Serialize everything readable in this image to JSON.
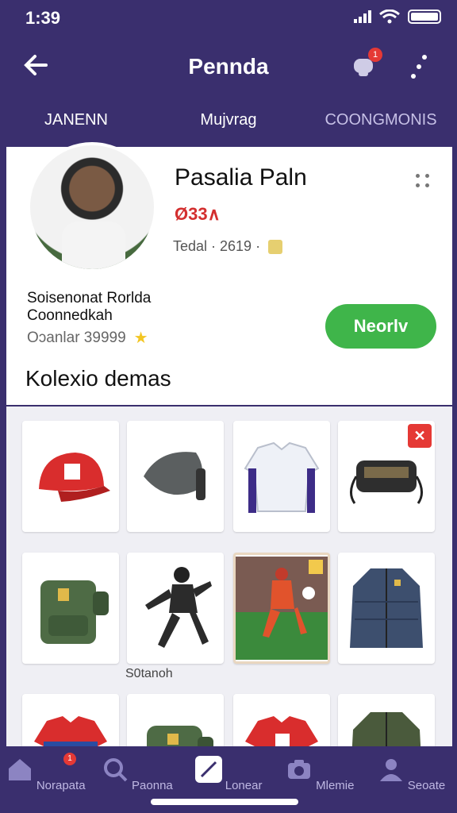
{
  "status": {
    "time": "1:39"
  },
  "header": {
    "title": "Pennda"
  },
  "tabs": [
    "JANENN",
    "Mujvrag",
    "COONGMONIS"
  ],
  "profile": {
    "name": "Pasalia Paln",
    "rank": "Ø33∧",
    "meta_text": "Tedal · 2619 ·",
    "bio_line1": "Soisenonat Rorlda",
    "bio_line2": "Coonnedkah",
    "stats_text": "Oɔanlar 39999",
    "follow_label": "Neorlv"
  },
  "collection": {
    "title": "Kolexio demas",
    "label": "S0tanoh",
    "items": [
      {
        "name": "red cap"
      },
      {
        "name": "grey sling bag"
      },
      {
        "name": "white jersey"
      },
      {
        "name": "black bag"
      },
      {
        "name": "green backpack"
      },
      {
        "name": "armored figure"
      },
      {
        "name": "player card"
      },
      {
        "name": "puffer jacket"
      },
      {
        "name": "red jersey"
      },
      {
        "name": "green bag"
      },
      {
        "name": "red jersey 2"
      },
      {
        "name": "green jacket"
      }
    ]
  },
  "bottom_nav": [
    "Norapata",
    "Paonna",
    "Lonear",
    "Mlemie",
    "Seoate"
  ],
  "colors": {
    "header_bg": "#3a2f6e",
    "accent_green": "#3fb54a",
    "accent_red": "#e53935"
  }
}
